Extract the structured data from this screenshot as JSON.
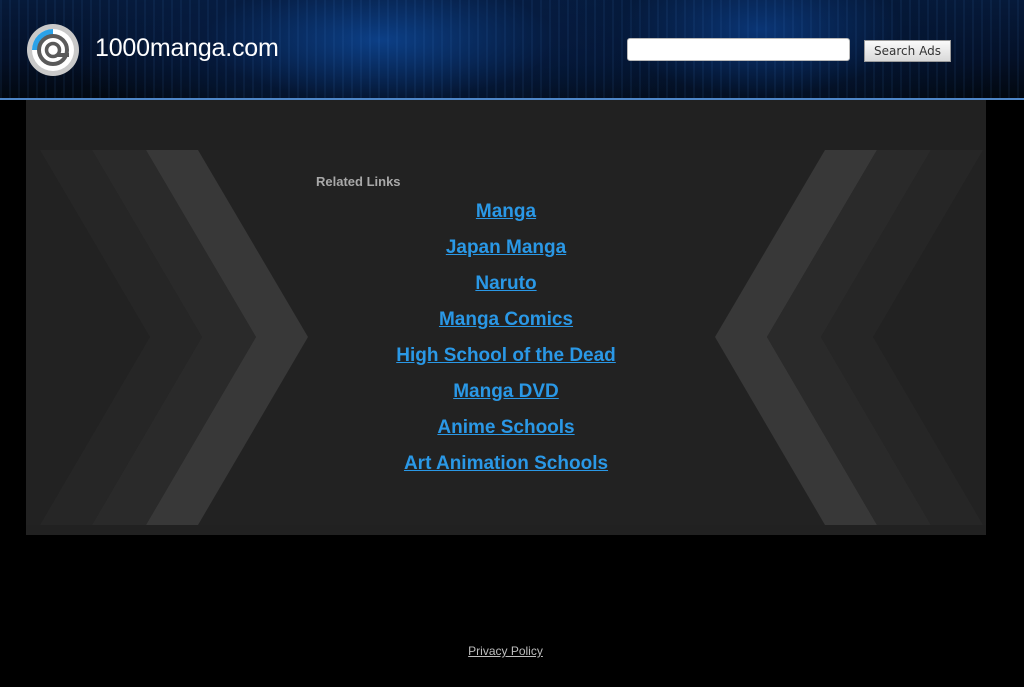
{
  "header": {
    "site_name": "1000manga.com",
    "search": {
      "value": "",
      "placeholder": "",
      "button_label": "Search Ads"
    }
  },
  "related": {
    "title": "Related Links",
    "links": [
      "Manga",
      "Japan Manga",
      "Naruto",
      "Manga Comics",
      "High School of the Dead",
      "Manga DVD",
      "Anime Schools",
      "Art Animation Schools"
    ]
  },
  "footer": {
    "privacy_label": "Privacy Policy"
  },
  "colors": {
    "link": "#2a98e6",
    "header_border": "#4f87c8",
    "panel_bg": "#212121",
    "page_bg": "#000000"
  },
  "icons": {
    "logo": "circular-swirl-logo-icon"
  }
}
